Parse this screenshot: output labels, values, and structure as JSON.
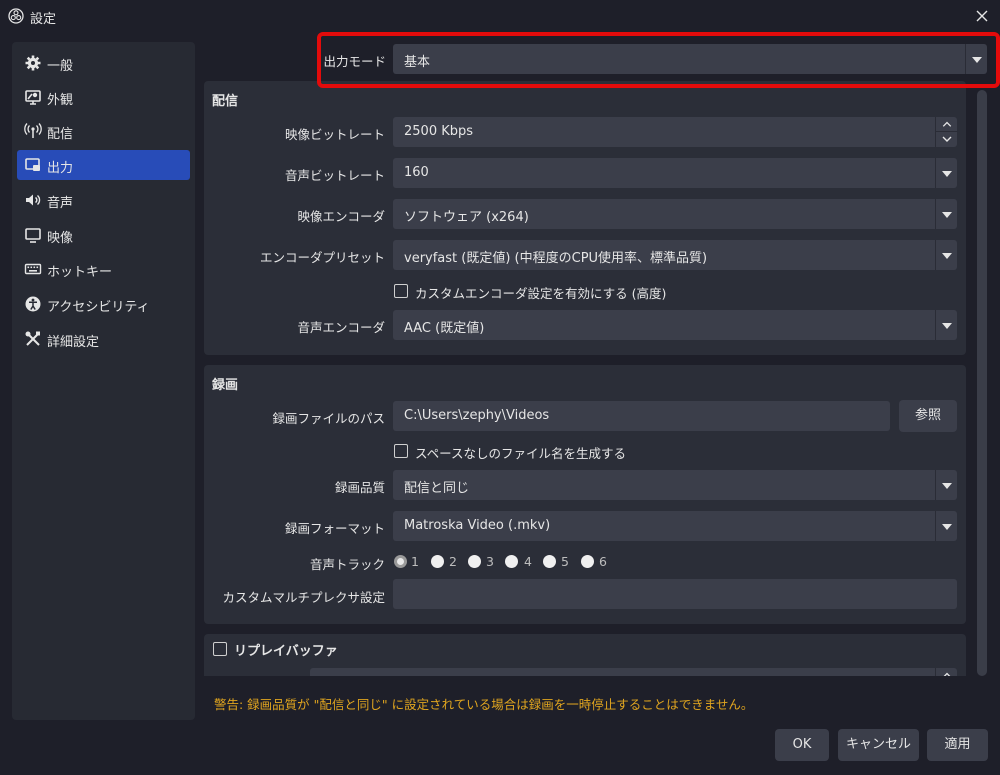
{
  "window": {
    "title": "設定"
  },
  "sidebar": {
    "items": [
      {
        "label": "一般",
        "icon": "gear-icon"
      },
      {
        "label": "外観",
        "icon": "appearance-icon"
      },
      {
        "label": "配信",
        "icon": "broadcast-icon"
      },
      {
        "label": "出力",
        "icon": "output-icon",
        "active": true
      },
      {
        "label": "音声",
        "icon": "speaker-icon"
      },
      {
        "label": "映像",
        "icon": "monitor-icon"
      },
      {
        "label": "ホットキー",
        "icon": "keyboard-icon"
      },
      {
        "label": "アクセシビリティ",
        "icon": "accessibility-icon"
      },
      {
        "label": "詳細設定",
        "icon": "tools-icon"
      }
    ]
  },
  "output_mode": {
    "label": "出力モード",
    "value": "基本"
  },
  "streaming": {
    "title": "配信",
    "video_bitrate": {
      "label": "映像ビットレート",
      "value": "2500 Kbps"
    },
    "audio_bitrate": {
      "label": "音声ビットレート",
      "value": "160"
    },
    "video_encoder": {
      "label": "映像エンコーダ",
      "value": "ソフトウェア (x264)"
    },
    "encoder_preset": {
      "label": "エンコーダプリセット",
      "value": "veryfast (既定値) (中程度のCPU使用率、標準品質)"
    },
    "custom_encoder_checkbox": {
      "label": "カスタムエンコーダ設定を有効にする (高度)",
      "checked": false
    },
    "audio_encoder": {
      "label": "音声エンコーダ",
      "value": "AAC (既定値)"
    }
  },
  "recording": {
    "title": "録画",
    "path": {
      "label": "録画ファイルのパス",
      "value": "C:\\Users\\zephy\\Videos",
      "browse_label": "参照"
    },
    "no_space_checkbox": {
      "label": "スペースなしのファイル名を生成する",
      "checked": false
    },
    "quality": {
      "label": "録画品質",
      "value": "配信と同じ"
    },
    "format": {
      "label": "録画フォーマット",
      "value": "Matroska Video (.mkv)"
    },
    "audio_track": {
      "label": "音声トラック",
      "tracks": [
        "1",
        "2",
        "3",
        "4",
        "5",
        "6"
      ],
      "selected": "1"
    },
    "muxer": {
      "label": "カスタムマルチプレクサ設定",
      "value": ""
    }
  },
  "replay_buffer": {
    "label": "リプレイバッファ",
    "checked": false
  },
  "warning": "警告: 録画品質が \"配信と同じ\" に設定されている場合は録画を一時停止することはできません。",
  "buttons": {
    "ok": "OK",
    "cancel": "キャンセル",
    "apply": "適用"
  },
  "colors": {
    "accent": "#284cb8",
    "highlight": "#e30b0b",
    "warning": "#e0a51f"
  }
}
